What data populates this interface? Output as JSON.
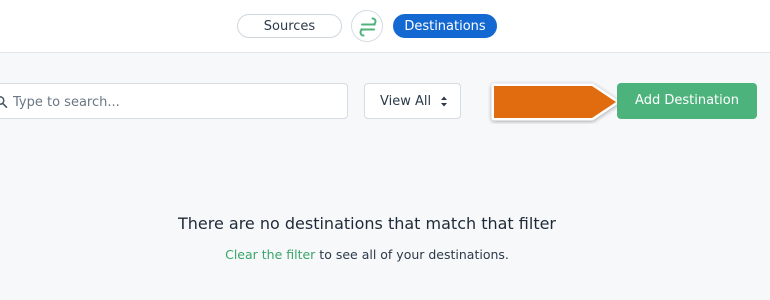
{
  "header": {
    "tabs": [
      {
        "label": "Sources",
        "active": false
      },
      {
        "label": "Destinations",
        "active": true
      }
    ],
    "logo_icon": "segment-logo-icon",
    "active_color": "#1468d1"
  },
  "toolbar": {
    "search_placeholder": "Type to search...",
    "search_icon": "search-icon",
    "filter_value": "View All",
    "filter_icon": "updown-chevron-icon",
    "add_label": "Add Destination",
    "add_color": "#4db37d",
    "annotation_color": "#e06c0f"
  },
  "empty_state": {
    "title": "There are no destinations that match that filter",
    "link_text": "Clear the filter",
    "rest_text": " to see all of your destinations."
  }
}
